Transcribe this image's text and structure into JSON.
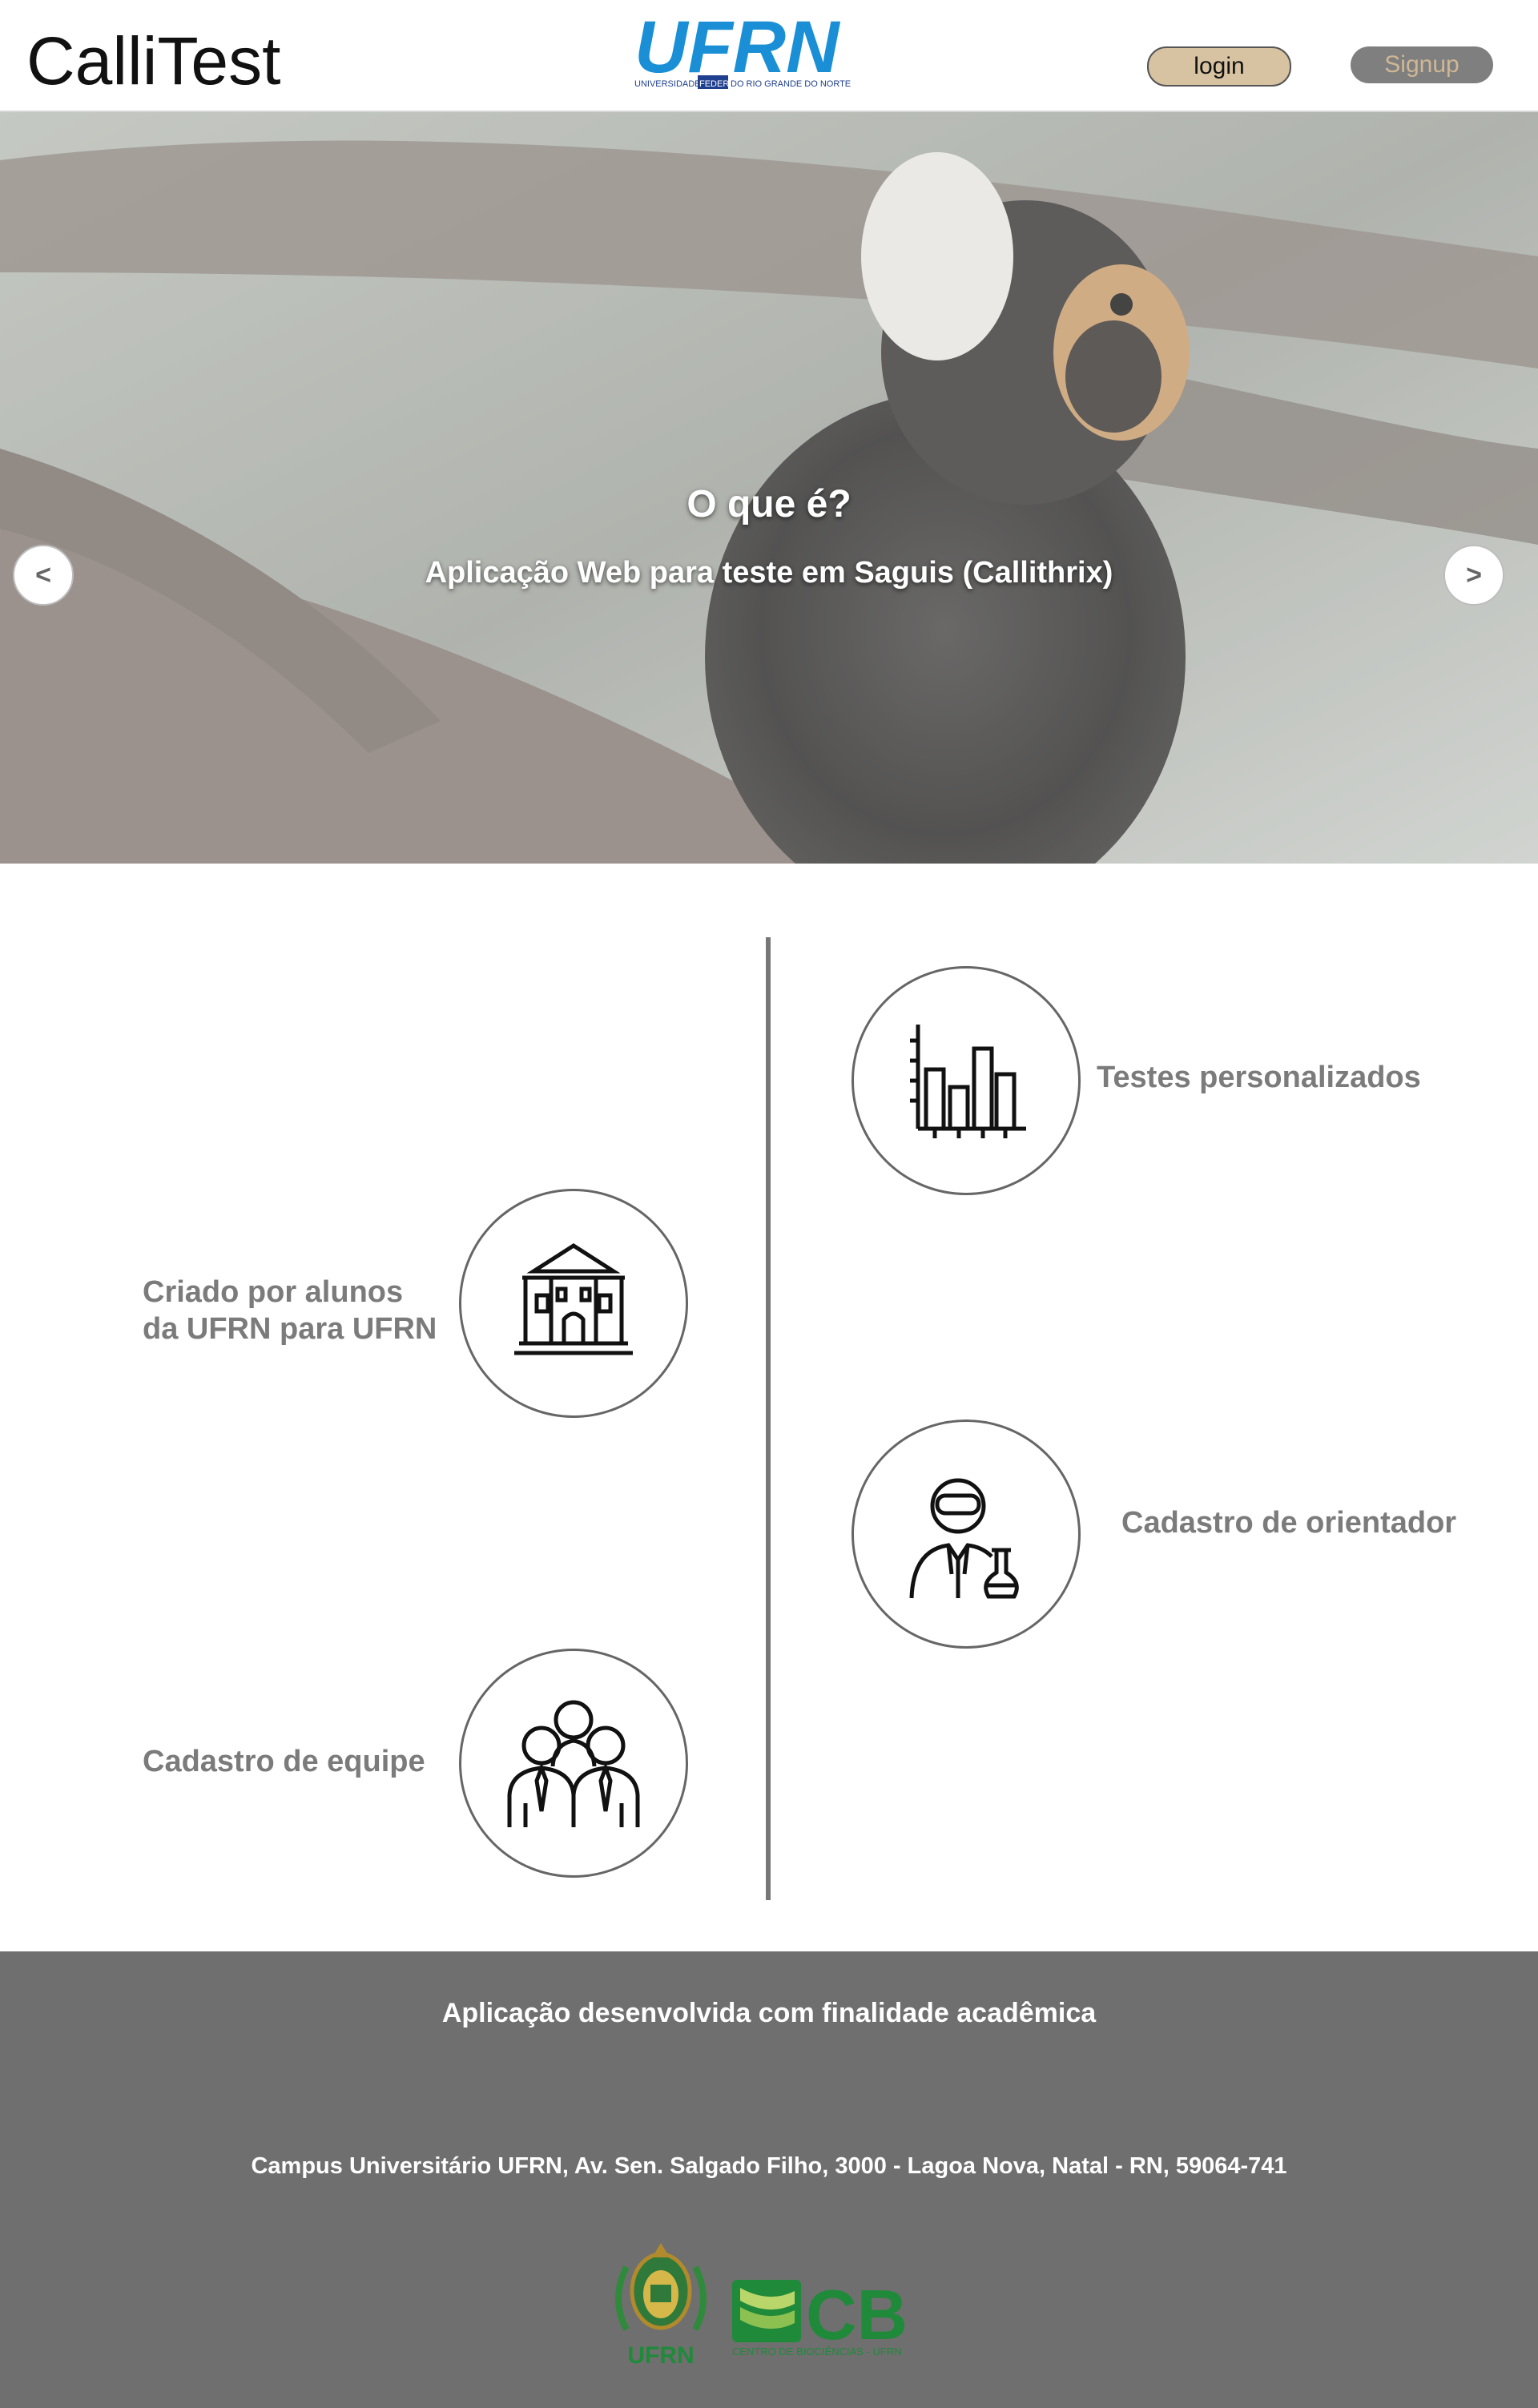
{
  "header": {
    "app_title": "CalliTest",
    "logo": {
      "main": "UFRN",
      "tagline_parts": [
        "UNIVERSIDADE",
        "FEDERAL",
        "DO RIO GRANDE DO NORTE"
      ]
    },
    "login_label": "login",
    "signup_label": "Signup"
  },
  "hero": {
    "title": "O que é?",
    "subtitle": "Aplicação Web para teste em Saguis (Callithrix)",
    "prev_icon": "chevron-left-icon",
    "next_icon": "chevron-right-icon"
  },
  "features": [
    {
      "label": "Testes personalizados",
      "icon": "bar-chart-icon"
    },
    {
      "label_line1": "Criado por alunos",
      "label_line2": "da UFRN para UFRN",
      "icon": "university-building-icon"
    },
    {
      "label": "Cadastro de orientador",
      "icon": "scientist-icon"
    },
    {
      "label": "Cadastro de equipe",
      "icon": "team-icon"
    }
  ],
  "footer": {
    "title": "Aplicação desenvolvida com finalidade acadêmica",
    "address": "Campus Universitário UFRN, Av. Sen. Salgado Filho, 3000 - Lagoa Nova, Natal - RN, 59064-741",
    "seal_logo_text": "UFRN",
    "cb_logo": {
      "main": "CB",
      "caption": "CENTRO DE BIOCIÊNCIAS - UFRN"
    }
  },
  "colors": {
    "ufrn_blue": "#1a8fd6",
    "ufrn_dark_blue": "#1f3f8f",
    "login_bg": "#d7c2a1",
    "signup_bg": "#7f7f7f",
    "footer_bg": "#6f6f6f",
    "feature_text": "#7b7b7b",
    "logo_green": "#1f8a3a"
  }
}
